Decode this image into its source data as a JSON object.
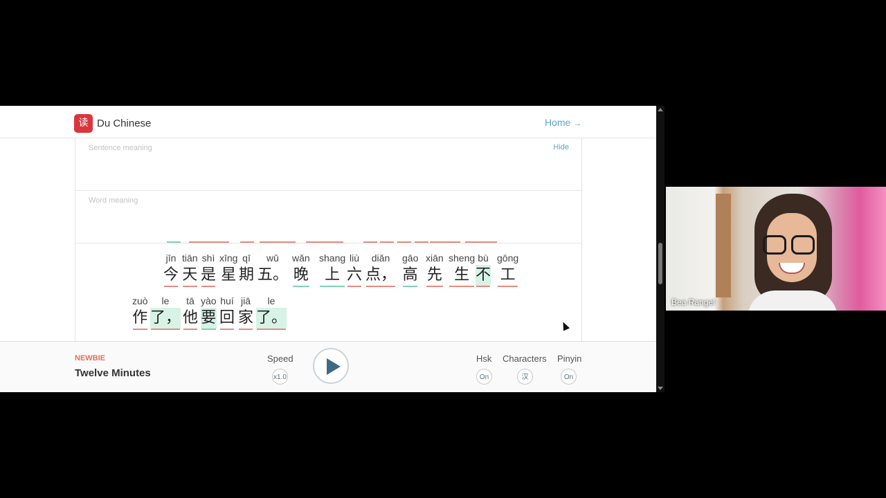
{
  "app": {
    "brand": "Du Chinese",
    "logo_glyph": "读",
    "home_link": "Home",
    "home_arrow": "→"
  },
  "panels": {
    "sentence_label": "Sentence meaning",
    "hide_label": "Hide",
    "word_label": "Word meaning"
  },
  "colors": {
    "accent_blue": "#5ea3cf",
    "underline_red": "#e88a7e",
    "underline_teal": "#7fd3b2",
    "highlight": "#d6f3e6",
    "level_orange": "#e0715d"
  },
  "lines": [
    [
      {
        "py": "jīn",
        "hz": "今",
        "ul": "red"
      },
      {
        "py": "tiān",
        "hz": "天",
        "ul": "red"
      },
      {
        "py": "shì",
        "hz": "是",
        "ul": "red"
      },
      {
        "py": "xīng",
        "hz": "星",
        "ul": ""
      },
      {
        "py": "qī",
        "hz": "期",
        "ul": ""
      },
      {
        "py": "wǔ",
        "hz": "五。",
        "ul": ""
      },
      {
        "py": "wǎn",
        "hz": "晚",
        "ul": "teal"
      },
      {
        "py": "shang",
        "hz": "上",
        "ul": "teal"
      },
      {
        "py": "liù",
        "hz": "六",
        "ul": "red"
      },
      {
        "py": "diǎn",
        "hz": "点，",
        "ul": "red"
      },
      {
        "py": "gāo",
        "hz": "高",
        "ul": "teal"
      },
      {
        "py": "xiān",
        "hz": "先",
        "ul": "red"
      },
      {
        "py": "sheng",
        "hz": "生",
        "ul": "red"
      },
      {
        "py": "bù",
        "hz": "不",
        "ul": "red",
        "hl": true
      },
      {
        "py": "gōng",
        "hz": "工",
        "ul": "red"
      }
    ],
    [
      {
        "py": "zuò",
        "hz": "作",
        "ul": "red"
      },
      {
        "py": "le",
        "hz": "了，",
        "ul": "red",
        "hl": true
      },
      {
        "py": "tā",
        "hz": "他",
        "ul": "red"
      },
      {
        "py": "yào",
        "hz": "要",
        "ul": "teal",
        "hl": true
      },
      {
        "py": "huí",
        "hz": "回",
        "ul": "red"
      },
      {
        "py": "jiā",
        "hz": "家",
        "ul": "red"
      },
      {
        "py": "le",
        "hz": "了。",
        "ul": "red",
        "hl": true
      }
    ]
  ],
  "lesson": {
    "level": "NEWBIE",
    "title": "Twelve Minutes"
  },
  "controls": {
    "speed_label": "Speed",
    "speed_value": "x1.0",
    "hsk_label": "Hsk",
    "hsk_value": "On",
    "characters_label": "Characters",
    "characters_value": "汉",
    "pinyin_label": "Pinyin",
    "pinyin_value": "On"
  },
  "video": {
    "participant_name": "Bea Rangel"
  }
}
